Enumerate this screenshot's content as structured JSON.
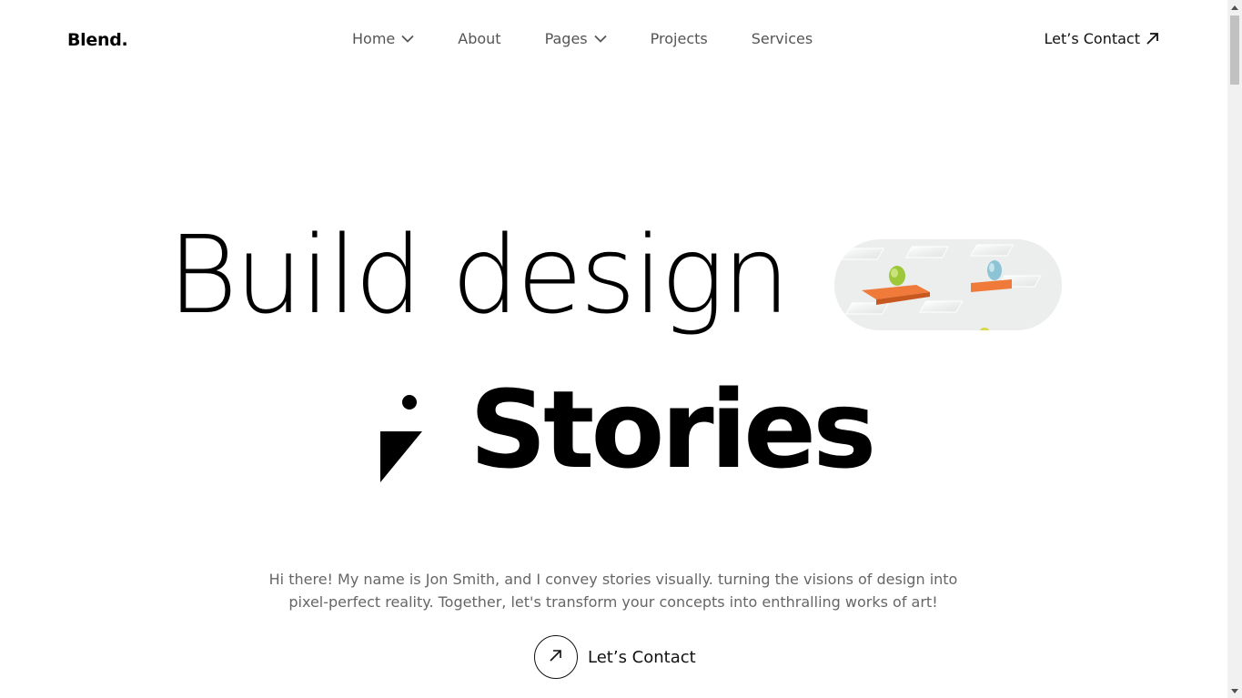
{
  "header": {
    "logo": "Blend.",
    "nav": [
      {
        "label": "Home",
        "icon": "chevron-down-icon"
      },
      {
        "label": "About"
      },
      {
        "label": "Pages",
        "icon": "chevron-down-icon"
      },
      {
        "label": "Projects"
      },
      {
        "label": "Services"
      }
    ],
    "cta_label": "Let’s Contact",
    "cta_icon": "arrow-up-right-icon"
  },
  "hero": {
    "line1": "Build design",
    "line2": "Stories",
    "image_alt": "3D illustration of floating orange platforms with spheres",
    "intro": "Hi there! My name is Jon Smith, and I convey stories visually. turning the visions of design into pixel-perfect reality. Together, let's transform your concepts into enthralling works of art!",
    "cta_label": "Let’s Contact",
    "cta_icon": "arrow-up-right-icon"
  },
  "colors": {
    "text": "#000000",
    "muted": "#666666",
    "nav": "#555555",
    "accent_orange": "#f07a3a"
  }
}
